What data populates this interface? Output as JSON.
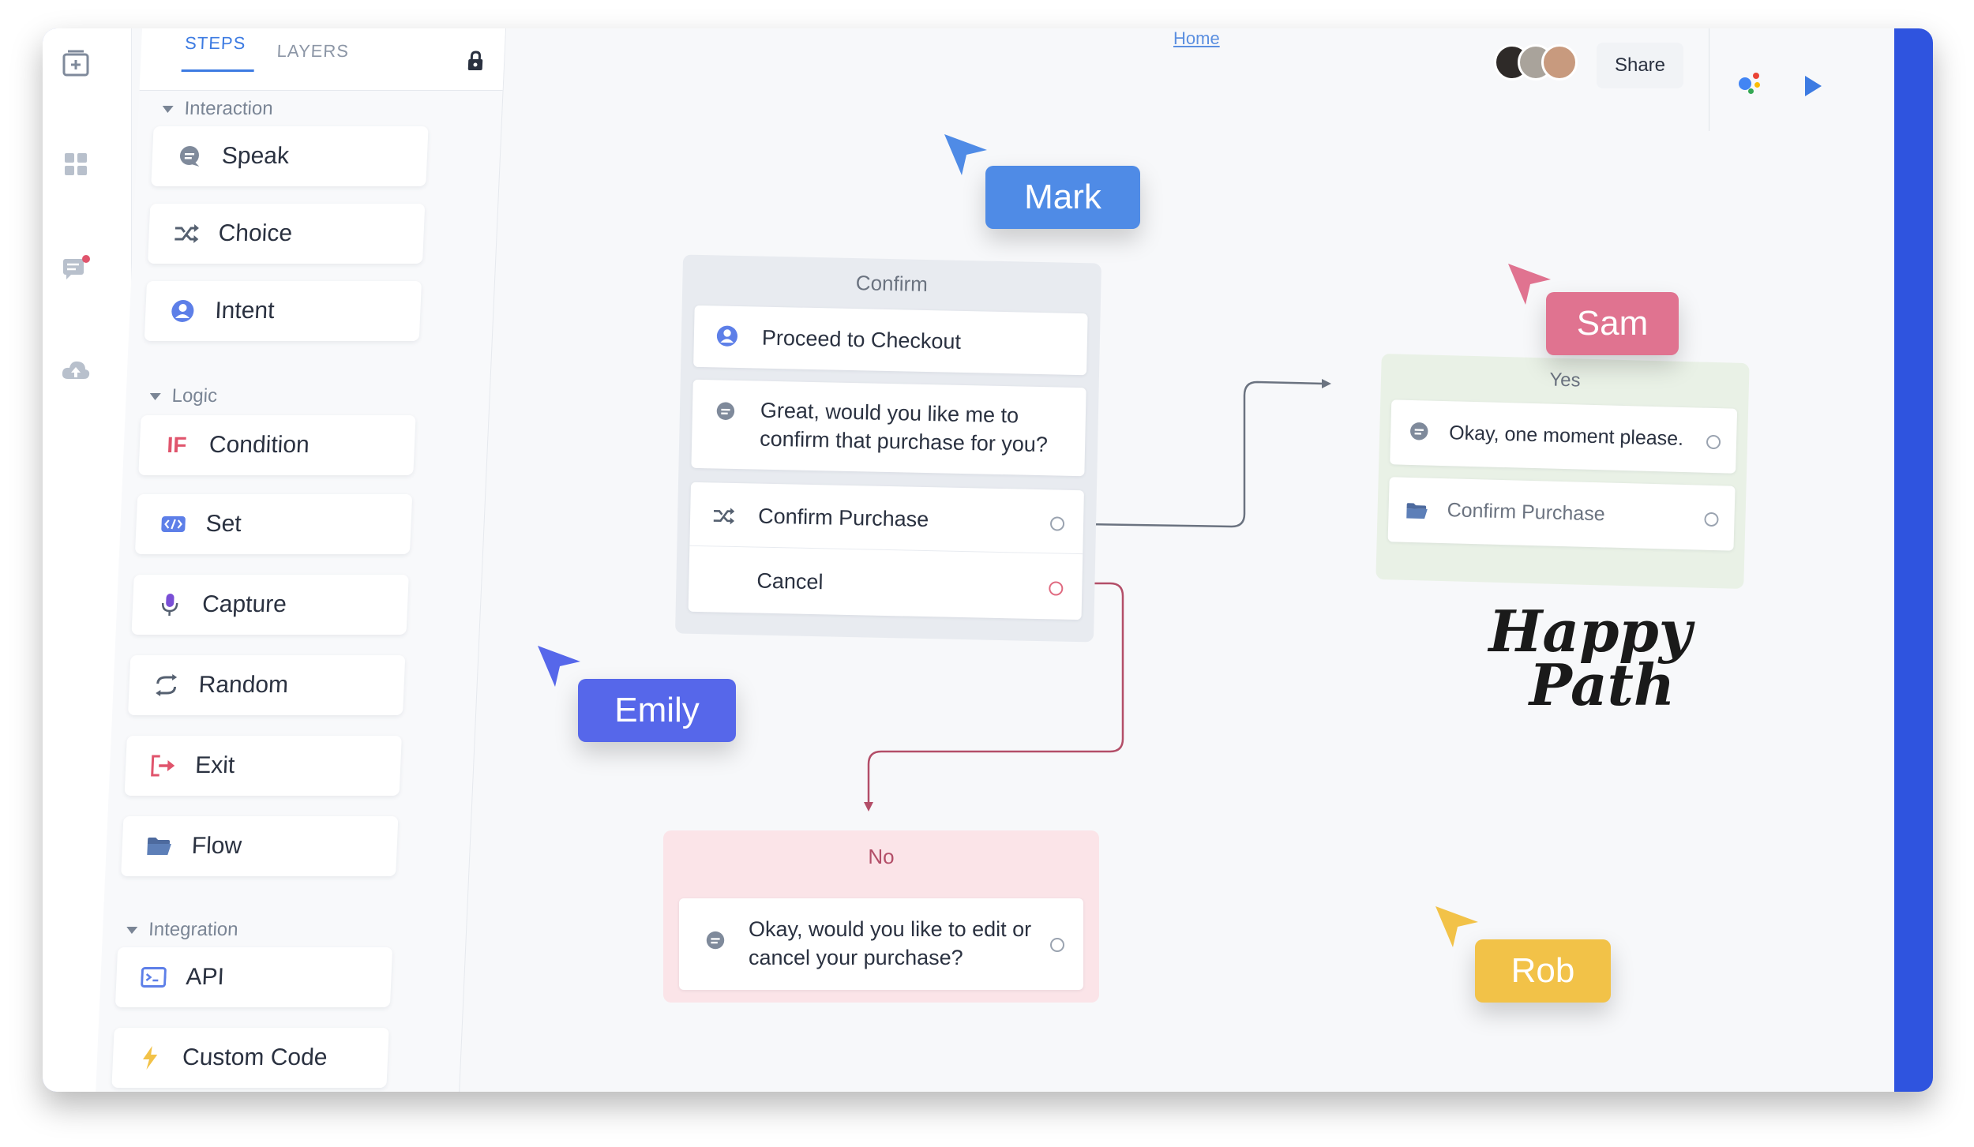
{
  "sidebar_tabs": {
    "steps": "STEPS",
    "layers": "LAYERS"
  },
  "sections": {
    "interaction": "Interaction",
    "logic": "Logic",
    "integration": "Integration"
  },
  "steps": {
    "speak": "Speak",
    "choice": "Choice",
    "intent": "Intent",
    "condition_badge": "IF",
    "condition": "Condition",
    "set": "Set",
    "capture": "Capture",
    "random": "Random",
    "exit": "Exit",
    "flow": "Flow",
    "api": "API",
    "custom_code": "Custom Code"
  },
  "header": {
    "canvas_title": "Home",
    "share_label": "Share"
  },
  "blocks": {
    "confirm": {
      "title": "Confirm",
      "intent_text": "Proceed to Checkout",
      "speak_line1": "Great, would you like me to",
      "speak_line2": "confirm that purchase for you?",
      "choice_text": "Confirm Purchase",
      "cancel_text": "Cancel"
    },
    "yes": {
      "title": "Yes",
      "speak_text": "Okay, one moment please.",
      "flow_text": "Confirm Purchase"
    },
    "no": {
      "title": "No",
      "speak_line1": "Okay, would you like to edit or",
      "speak_line2": "cancel your purchase?"
    }
  },
  "collaborators": {
    "mark": {
      "name": "Mark",
      "color": "#4f8be6"
    },
    "sam": {
      "name": "Sam",
      "color": "#e07390"
    },
    "emily": {
      "name": "Emily",
      "color": "#5667ea"
    },
    "rob": {
      "name": "Rob",
      "color": "#f2c248"
    }
  },
  "annotation": {
    "line1": "Happy",
    "line2": "Path"
  },
  "colors": {
    "accent": "#3d7be2",
    "frame": "#2f54df",
    "yes_block": "#e9f1e6",
    "no_block": "#fbe4e8",
    "connector_gray": "#6b7380",
    "connector_red": "#b34e68"
  }
}
